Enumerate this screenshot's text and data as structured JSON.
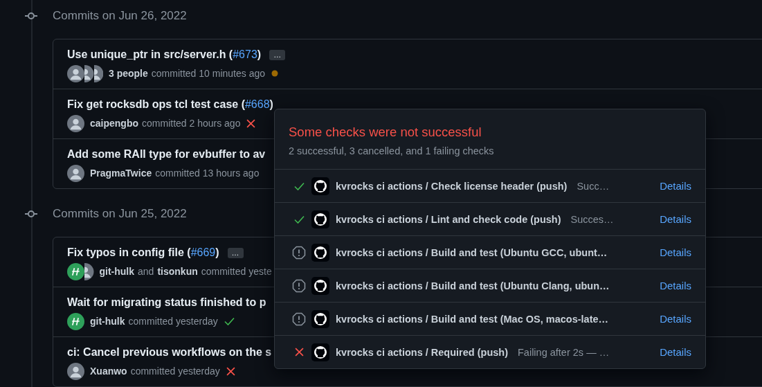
{
  "groups": [
    {
      "heading": "Commits on Jun 26, 2022",
      "commits": [
        {
          "title": "Use unique_ptr in src/server.h (",
          "pr": "#673",
          "title_end": ")",
          "more": "…",
          "avatars": [
            {
              "kind": "photo"
            },
            {
              "kind": "photo"
            },
            {
              "kind": "photo"
            }
          ],
          "meta": [
            {
              "kind": "author",
              "text": "3 people"
            },
            {
              "kind": "text",
              "text": "committed 10 minutes ago"
            }
          ],
          "status": {
            "kind": "pending"
          }
        },
        {
          "title": "Fix get rocksdb ops tcl test case (",
          "pr": "#668",
          "title_end": ")",
          "avatars": [
            {
              "kind": "photo"
            }
          ],
          "meta": [
            {
              "kind": "author",
              "text": "caipengbo"
            },
            {
              "kind": "text",
              "text": "committed 2 hours ago"
            }
          ],
          "status": {
            "kind": "failure"
          }
        },
        {
          "title": "Add some RAII type for evbuffer to av",
          "avatars": [
            {
              "kind": "photo"
            }
          ],
          "meta": [
            {
              "kind": "author",
              "text": "PragmaTwice"
            },
            {
              "kind": "text",
              "text": "committed 13 hours ago"
            }
          ]
        }
      ]
    },
    {
      "heading": "Commits on Jun 25, 2022",
      "commits": [
        {
          "title": "Fix typos in config file (",
          "pr": "#669",
          "title_end": ")",
          "more": "…",
          "avatars": [
            {
              "kind": "identicon"
            },
            {
              "kind": "photo"
            }
          ],
          "meta": [
            {
              "kind": "author",
              "text": "git-hulk"
            },
            {
              "kind": "text",
              "text": "and"
            },
            {
              "kind": "author",
              "text": "tisonkun"
            },
            {
              "kind": "text",
              "text": "committed yeste"
            }
          ]
        },
        {
          "title": "Wait for migrating status finished to p",
          "avatars": [
            {
              "kind": "identicon"
            }
          ],
          "meta": [
            {
              "kind": "author",
              "text": "git-hulk"
            },
            {
              "kind": "text",
              "text": "committed yesterday"
            }
          ],
          "status": {
            "kind": "success"
          }
        },
        {
          "title": "ci: Cancel previous workflows on the s",
          "avatars": [
            {
              "kind": "photo"
            }
          ],
          "meta": [
            {
              "kind": "author",
              "text": "Xuanwo"
            },
            {
              "kind": "text",
              "text": "committed yesterday"
            }
          ],
          "status": {
            "kind": "failure"
          }
        }
      ]
    }
  ],
  "popover": {
    "title": "Some checks were not successful",
    "summary": "2 successful, 3 cancelled, and 1 failing checks",
    "checks": [
      {
        "status": {
          "kind": "success"
        },
        "name": "kvrocks ci actions / Check license header (push)",
        "description": "Succ…",
        "link": "Details"
      },
      {
        "status": {
          "kind": "success"
        },
        "name": "kvrocks ci actions / Lint and check code (push)",
        "description": "Succes…",
        "link": "Details"
      },
      {
        "status": {
          "kind": "cancelled"
        },
        "name": "kvrocks ci actions / Build and test (Ubuntu GCC, ubunt…",
        "link": "Details"
      },
      {
        "status": {
          "kind": "cancelled"
        },
        "name": "kvrocks ci actions / Build and test (Ubuntu Clang, ubun…",
        "link": "Details"
      },
      {
        "status": {
          "kind": "cancelled"
        },
        "name": "kvrocks ci actions / Build and test (Mac OS, macos-late…",
        "link": "Details"
      },
      {
        "status": {
          "kind": "failure"
        },
        "name": "kvrocks ci actions / Required (push)",
        "description": "Failing after 2s — …",
        "link": "Details"
      }
    ]
  }
}
